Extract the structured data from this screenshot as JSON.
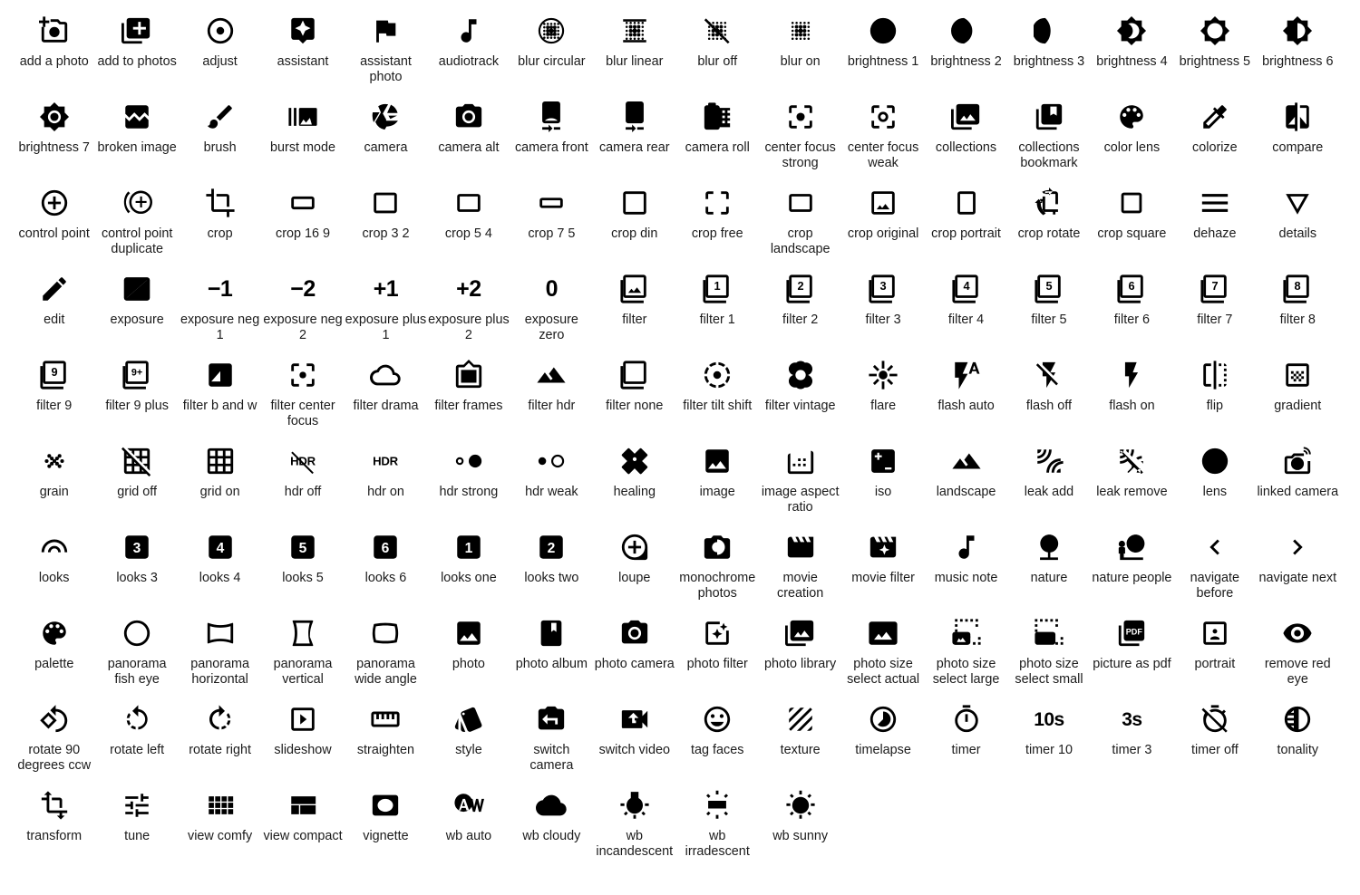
{
  "page": {
    "title": "Material Design Image Icons",
    "background_color": "#ffffff",
    "icon_color": "#000000",
    "label_color": "#1b1b1b",
    "columns": 16,
    "rows": 10,
    "total_icons": 155
  },
  "icons": [
    {
      "label": "add a photo",
      "icon": "add-a-photo-icon"
    },
    {
      "label": "add to photos",
      "icon": "add-to-photos-icon"
    },
    {
      "label": "adjust",
      "icon": "adjust-icon"
    },
    {
      "label": "assistant",
      "icon": "assistant-icon"
    },
    {
      "label": "assistant photo",
      "icon": "assistant-photo-icon"
    },
    {
      "label": "audiotrack",
      "icon": "audiotrack-icon"
    },
    {
      "label": "blur circular",
      "icon": "blur-circular-icon"
    },
    {
      "label": "blur linear",
      "icon": "blur-linear-icon"
    },
    {
      "label": "blur off",
      "icon": "blur-off-icon"
    },
    {
      "label": "blur on",
      "icon": "blur-on-icon"
    },
    {
      "label": "brightness 1",
      "icon": "brightness-1-icon"
    },
    {
      "label": "brightness 2",
      "icon": "brightness-2-icon"
    },
    {
      "label": "brightness 3",
      "icon": "brightness-3-icon"
    },
    {
      "label": "brightness 4",
      "icon": "brightness-4-icon"
    },
    {
      "label": "brightness 5",
      "icon": "brightness-5-icon"
    },
    {
      "label": "brightness 6",
      "icon": "brightness-6-icon"
    },
    {
      "label": "brightness 7",
      "icon": "brightness-7-icon"
    },
    {
      "label": "broken image",
      "icon": "broken-image-icon"
    },
    {
      "label": "brush",
      "icon": "brush-icon"
    },
    {
      "label": "burst mode",
      "icon": "burst-mode-icon"
    },
    {
      "label": "camera",
      "icon": "camera-icon"
    },
    {
      "label": "camera alt",
      "icon": "camera-alt-icon"
    },
    {
      "label": "camera front",
      "icon": "camera-front-icon"
    },
    {
      "label": "camera rear",
      "icon": "camera-rear-icon"
    },
    {
      "label": "camera roll",
      "icon": "camera-roll-icon"
    },
    {
      "label": "center focus strong",
      "icon": "center-focus-strong-icon"
    },
    {
      "label": "center focus weak",
      "icon": "center-focus-weak-icon"
    },
    {
      "label": "collections",
      "icon": "collections-icon"
    },
    {
      "label": "collections bookmark",
      "icon": "collections-bookmark-icon"
    },
    {
      "label": "color lens",
      "icon": "color-lens-icon"
    },
    {
      "label": "colorize",
      "icon": "colorize-icon"
    },
    {
      "label": "compare",
      "icon": "compare-icon"
    },
    {
      "label": "control point",
      "icon": "control-point-icon"
    },
    {
      "label": "control point duplicate",
      "icon": "control-point-duplicate-icon"
    },
    {
      "label": "crop",
      "icon": "crop-icon"
    },
    {
      "label": "crop 16 9",
      "icon": "crop-16-9-icon"
    },
    {
      "label": "crop 3 2",
      "icon": "crop-3-2-icon"
    },
    {
      "label": "crop 5 4",
      "icon": "crop-5-4-icon"
    },
    {
      "label": "crop 7 5",
      "icon": "crop-7-5-icon"
    },
    {
      "label": "crop din",
      "icon": "crop-din-icon"
    },
    {
      "label": "crop free",
      "icon": "crop-free-icon"
    },
    {
      "label": "crop landscape",
      "icon": "crop-landscape-icon"
    },
    {
      "label": "crop original",
      "icon": "crop-original-icon"
    },
    {
      "label": "crop portrait",
      "icon": "crop-portrait-icon"
    },
    {
      "label": "crop rotate",
      "icon": "crop-rotate-icon"
    },
    {
      "label": "crop square",
      "icon": "crop-square-icon"
    },
    {
      "label": "dehaze",
      "icon": "dehaze-icon"
    },
    {
      "label": "details",
      "icon": "details-icon"
    },
    {
      "label": "edit",
      "icon": "edit-icon"
    },
    {
      "label": "exposure",
      "icon": "exposure-icon"
    },
    {
      "label": "exposure neg 1",
      "icon": "exposure-neg-1-icon"
    },
    {
      "label": "exposure neg 2",
      "icon": "exposure-neg-2-icon"
    },
    {
      "label": "exposure plus 1",
      "icon": "exposure-plus-1-icon"
    },
    {
      "label": "exposure plus 2",
      "icon": "exposure-plus-2-icon"
    },
    {
      "label": "exposure zero",
      "icon": "exposure-zero-icon"
    },
    {
      "label": "filter",
      "icon": "filter-icon"
    },
    {
      "label": "filter 1",
      "icon": "filter-1-icon"
    },
    {
      "label": "filter 2",
      "icon": "filter-2-icon"
    },
    {
      "label": "filter 3",
      "icon": "filter-3-icon"
    },
    {
      "label": "filter 4",
      "icon": "filter-4-icon"
    },
    {
      "label": "filter 5",
      "icon": "filter-5-icon"
    },
    {
      "label": "filter 6",
      "icon": "filter-6-icon"
    },
    {
      "label": "filter 7",
      "icon": "filter-7-icon"
    },
    {
      "label": "filter 8",
      "icon": "filter-8-icon"
    },
    {
      "label": "filter 9",
      "icon": "filter-9-icon"
    },
    {
      "label": "filter 9 plus",
      "icon": "filter-9-plus-icon"
    },
    {
      "label": "filter b and w",
      "icon": "filter-b-and-w-icon"
    },
    {
      "label": "filter center focus",
      "icon": "filter-center-focus-icon"
    },
    {
      "label": "filter drama",
      "icon": "filter-drama-icon"
    },
    {
      "label": "filter frames",
      "icon": "filter-frames-icon"
    },
    {
      "label": "filter hdr",
      "icon": "filter-hdr-icon"
    },
    {
      "label": "filter none",
      "icon": "filter-none-icon"
    },
    {
      "label": "filter tilt shift",
      "icon": "filter-tilt-shift-icon"
    },
    {
      "label": "filter vintage",
      "icon": "filter-vintage-icon"
    },
    {
      "label": "flare",
      "icon": "flare-icon"
    },
    {
      "label": "flash auto",
      "icon": "flash-auto-icon"
    },
    {
      "label": "flash off",
      "icon": "flash-off-icon"
    },
    {
      "label": "flash on",
      "icon": "flash-on-icon"
    },
    {
      "label": "flip",
      "icon": "flip-icon"
    },
    {
      "label": "gradient",
      "icon": "gradient-icon"
    },
    {
      "label": "grain",
      "icon": "grain-icon"
    },
    {
      "label": "grid off",
      "icon": "grid-off-icon"
    },
    {
      "label": "grid on",
      "icon": "grid-on-icon"
    },
    {
      "label": "hdr off",
      "icon": "hdr-off-icon"
    },
    {
      "label": "hdr on",
      "icon": "hdr-on-icon"
    },
    {
      "label": "hdr strong",
      "icon": "hdr-strong-icon"
    },
    {
      "label": "hdr weak",
      "icon": "hdr-weak-icon"
    },
    {
      "label": "healing",
      "icon": "healing-icon"
    },
    {
      "label": "image",
      "icon": "image-icon"
    },
    {
      "label": "image aspect ratio",
      "icon": "image-aspect-ratio-icon"
    },
    {
      "label": "iso",
      "icon": "iso-icon"
    },
    {
      "label": "landscape",
      "icon": "landscape-icon"
    },
    {
      "label": "leak add",
      "icon": "leak-add-icon"
    },
    {
      "label": "leak remove",
      "icon": "leak-remove-icon"
    },
    {
      "label": "lens",
      "icon": "lens-icon"
    },
    {
      "label": "linked camera",
      "icon": "linked-camera-icon"
    },
    {
      "label": "looks",
      "icon": "looks-icon"
    },
    {
      "label": "looks 3",
      "icon": "looks-3-icon"
    },
    {
      "label": "looks 4",
      "icon": "looks-4-icon"
    },
    {
      "label": "looks 5",
      "icon": "looks-5-icon"
    },
    {
      "label": "looks 6",
      "icon": "looks-6-icon"
    },
    {
      "label": "looks one",
      "icon": "looks-one-icon"
    },
    {
      "label": "looks two",
      "icon": "looks-two-icon"
    },
    {
      "label": "loupe",
      "icon": "loupe-icon"
    },
    {
      "label": "monochrome photos",
      "icon": "monochrome-photos-icon"
    },
    {
      "label": "movie creation",
      "icon": "movie-creation-icon"
    },
    {
      "label": "movie filter",
      "icon": "movie-filter-icon"
    },
    {
      "label": "music note",
      "icon": "music-note-icon"
    },
    {
      "label": "nature",
      "icon": "nature-icon"
    },
    {
      "label": "nature people",
      "icon": "nature-people-icon"
    },
    {
      "label": "navigate before",
      "icon": "navigate-before-icon"
    },
    {
      "label": "navigate next",
      "icon": "navigate-next-icon"
    },
    {
      "label": "palette",
      "icon": "palette-icon"
    },
    {
      "label": "panorama fish eye",
      "icon": "panorama-fish-eye-icon"
    },
    {
      "label": "panorama horizontal",
      "icon": "panorama-horizontal-icon"
    },
    {
      "label": "panorama vertical",
      "icon": "panorama-vertical-icon"
    },
    {
      "label": "panorama wide angle",
      "icon": "panorama-wide-angle-icon"
    },
    {
      "label": "photo",
      "icon": "photo-icon"
    },
    {
      "label": "photo album",
      "icon": "photo-album-icon"
    },
    {
      "label": "photo camera",
      "icon": "photo-camera-icon"
    },
    {
      "label": "photo filter",
      "icon": "photo-filter-icon"
    },
    {
      "label": "photo library",
      "icon": "photo-library-icon"
    },
    {
      "label": "photo size select actual",
      "icon": "photo-size-select-actual-icon"
    },
    {
      "label": "photo size select large",
      "icon": "photo-size-select-large-icon"
    },
    {
      "label": "photo size select small",
      "icon": "photo-size-select-small-icon"
    },
    {
      "label": "picture as pdf",
      "icon": "picture-as-pdf-icon"
    },
    {
      "label": "portrait",
      "icon": "portrait-icon"
    },
    {
      "label": "remove red eye",
      "icon": "remove-red-eye-icon"
    },
    {
      "label": "rotate 90 degrees ccw",
      "icon": "rotate-90-degrees-ccw-icon"
    },
    {
      "label": "rotate left",
      "icon": "rotate-left-icon"
    },
    {
      "label": "rotate right",
      "icon": "rotate-right-icon"
    },
    {
      "label": "slideshow",
      "icon": "slideshow-icon"
    },
    {
      "label": "straighten",
      "icon": "straighten-icon"
    },
    {
      "label": "style",
      "icon": "style-icon"
    },
    {
      "label": "switch camera",
      "icon": "switch-camera-icon"
    },
    {
      "label": "switch video",
      "icon": "switch-video-icon"
    },
    {
      "label": "tag faces",
      "icon": "tag-faces-icon"
    },
    {
      "label": "texture",
      "icon": "texture-icon"
    },
    {
      "label": "timelapse",
      "icon": "timelapse-icon"
    },
    {
      "label": "timer",
      "icon": "timer-icon"
    },
    {
      "label": "timer 10",
      "icon": "timer-10-icon"
    },
    {
      "label": "timer 3",
      "icon": "timer-3-icon"
    },
    {
      "label": "timer off",
      "icon": "timer-off-icon"
    },
    {
      "label": "tonality",
      "icon": "tonality-icon"
    },
    {
      "label": "transform",
      "icon": "transform-icon"
    },
    {
      "label": "tune",
      "icon": "tune-icon"
    },
    {
      "label": "view comfy",
      "icon": "view-comfy-icon"
    },
    {
      "label": "view compact",
      "icon": "view-compact-icon"
    },
    {
      "label": "vignette",
      "icon": "vignette-icon"
    },
    {
      "label": "wb auto",
      "icon": "wb-auto-icon"
    },
    {
      "label": "wb cloudy",
      "icon": "wb-cloudy-icon"
    },
    {
      "label": "wb incandescent",
      "icon": "wb-incandescent-icon"
    },
    {
      "label": "wb irradescent",
      "icon": "wb-irradescent-icon"
    },
    {
      "label": "wb sunny",
      "icon": "wb-sunny-icon"
    }
  ]
}
